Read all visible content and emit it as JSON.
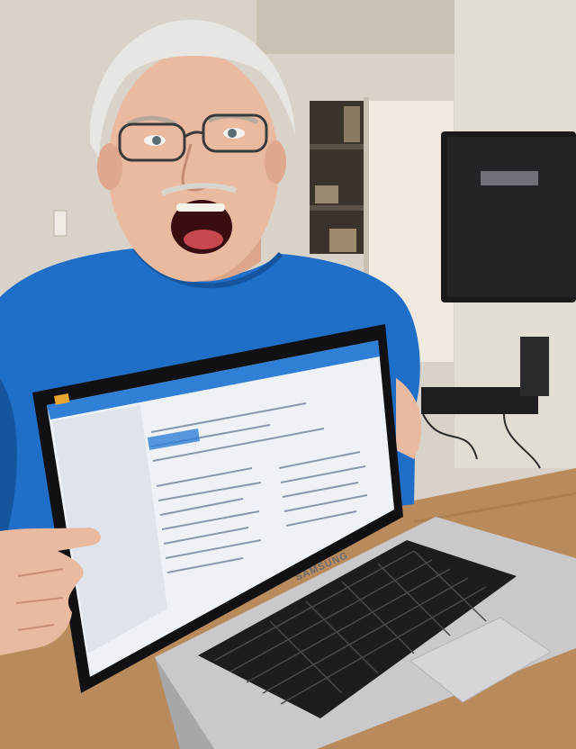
{
  "scene": {
    "subject": "man",
    "colors": {
      "wall": "#d8d2c8",
      "wall_shadow": "#bdb5a8",
      "shirt": "#1f6fc9",
      "shirt_shadow": "#15559e",
      "skin": "#e9b9a0",
      "hair": "#e8e6e2",
      "table": "#b98a5c",
      "tv": "#1a1a1a",
      "laptop_body": "#c9c9cb",
      "screen_blue": "#2f7fd6"
    }
  },
  "laptop": {
    "brand": "SAMSUNG"
  }
}
